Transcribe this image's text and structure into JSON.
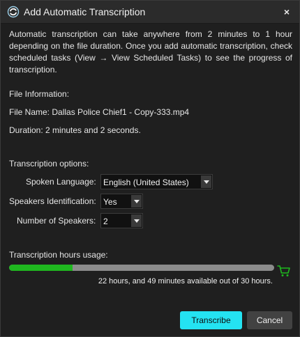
{
  "dialog": {
    "title": "Add Automatic Transcription",
    "close_label": "×",
    "intro": "Automatic transcription can take anywhere from 2 minutes to 1 hour depending on the file duration. Once you add automatic transcription, check scheduled tasks (View → View Scheduled Tasks) to see the progress of transcription."
  },
  "file_info": {
    "heading": "File Information:",
    "name_line": "File Name: Dallas Police Chief1 - Copy-333.mp4",
    "duration_line": "Duration: 2 minutes and 2 seconds."
  },
  "options": {
    "heading": "Transcription options:",
    "language_label": "Spoken Language:",
    "language_value": "English (United States)",
    "speaker_id_label": "Speakers Identification:",
    "speaker_id_value": "Yes",
    "speaker_count_label": "Number of Speakers:",
    "speaker_count_value": "2"
  },
  "usage": {
    "heading": "Transcription hours usage:",
    "available_fraction": 0.24,
    "note": "22 hours, and 49 minutes available out of 30 hours."
  },
  "buttons": {
    "transcribe": "Transcribe",
    "cancel": "Cancel"
  },
  "colors": {
    "accent": "#24e3f2",
    "progress": "#1fb81f",
    "cart": "#1fb81f"
  },
  "icons": {
    "app": "sync-logo-icon",
    "close": "close-icon",
    "cart": "shopping-cart-icon",
    "dropdown": "chevron-down-icon"
  }
}
